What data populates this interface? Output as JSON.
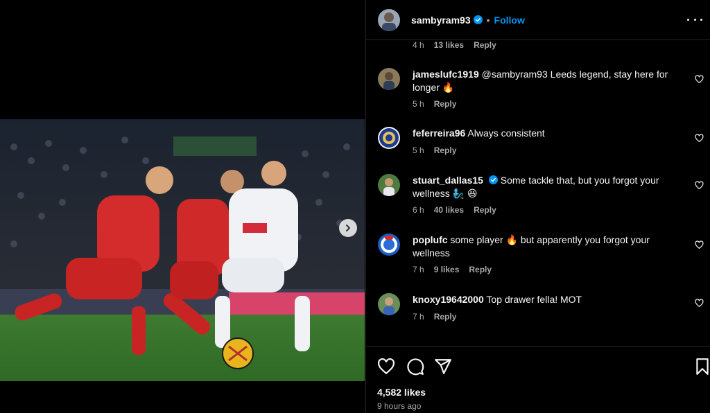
{
  "post": {
    "username": "sambyram93",
    "follow_label": "Follow",
    "separator": "•",
    "likes": "4,582 likes",
    "time_ago": "9 hours ago"
  },
  "previous_comment_meta": {
    "time": "4 h",
    "likes": "13 likes",
    "reply": "Reply"
  },
  "comments": [
    {
      "username": "jameslufc1919",
      "mention": "@sambyram93",
      "text": " Leeds legend, stay here for longer 🔥",
      "time": "5 h",
      "likes": "",
      "reply": "Reply",
      "verified": false
    },
    {
      "username": "feferreira96",
      "mention": "",
      "text": " Always consistent",
      "time": "5 h",
      "likes": "",
      "reply": "Reply",
      "verified": false
    },
    {
      "username": "stuart_dallas15",
      "mention": "",
      "text": " Some tackle that, but you forgot your wellness 🧞‍♂️ 😆",
      "time": "6 h",
      "likes": "40 likes",
      "reply": "Reply",
      "verified": true
    },
    {
      "username": "poplufc",
      "mention": "",
      "text": " some player 🔥  but apparently you forgot your wellness",
      "time": "7 h",
      "likes": "9 likes",
      "reply": "Reply",
      "verified": false
    },
    {
      "username": "knoxy19642000",
      "mention": "",
      "text": " Top drawer fella! MOT",
      "time": "7 h",
      "likes": "",
      "reply": "Reply",
      "verified": false
    }
  ],
  "colors": {
    "accent": "#0095f6",
    "background": "#000000",
    "muted": "#a8a8a8",
    "divider": "#262626"
  },
  "icons": [
    "verified-badge-icon",
    "more-options-icon",
    "heart-icon",
    "comment-icon",
    "share-icon",
    "bookmark-icon",
    "next-arrow-icon"
  ]
}
